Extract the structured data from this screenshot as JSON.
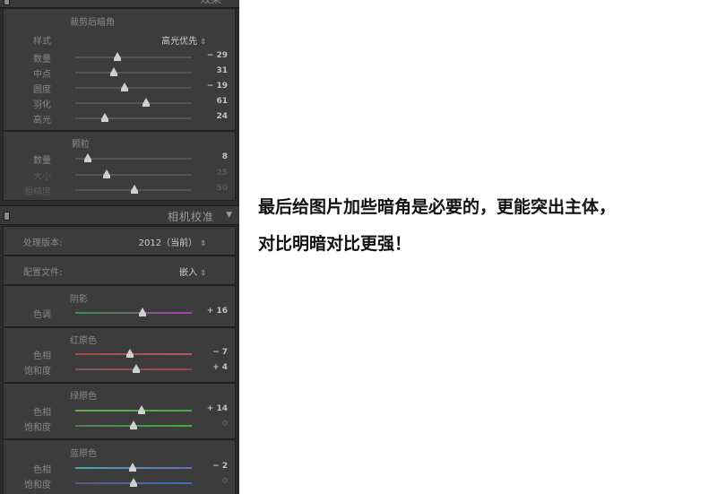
{
  "panel": {
    "top_header": {
      "title": "效果"
    },
    "vignette": {
      "title": "裁剪后暗角",
      "style_label": "样式",
      "style_value": "高光优先",
      "sliders": [
        {
          "label": "数量",
          "value": "− 29",
          "pos": 0.36
        },
        {
          "label": "中点",
          "value": "31",
          "pos": 0.33
        },
        {
          "label": "圆度",
          "value": "− 19",
          "pos": 0.42
        },
        {
          "label": "羽化",
          "value": "61",
          "pos": 0.61
        },
        {
          "label": "高光",
          "value": "24",
          "pos": 0.25
        }
      ]
    },
    "grain": {
      "title": "颗粒",
      "sliders": [
        {
          "label": "数量",
          "value": "8",
          "pos": 0.11
        },
        {
          "label": "大小",
          "value": "25",
          "pos": 0.27
        },
        {
          "label": "粗糙度",
          "value": "50",
          "pos": 0.51
        }
      ]
    },
    "camera_calibration": {
      "title": "相机校准",
      "process_label": "处理版本:",
      "process_value": "2012（当前）",
      "profile_label": "配置文件:",
      "profile_value": "嵌入",
      "shadows": {
        "title": "阴影",
        "sliders": [
          {
            "label": "色调",
            "value": "+ 16",
            "pos": 0.58
          }
        ]
      },
      "red": {
        "title": "红原色",
        "sliders": [
          {
            "label": "色相",
            "value": "− 7",
            "pos": 0.47
          },
          {
            "label": "饱和度",
            "value": "+ 4",
            "pos": 0.52
          }
        ]
      },
      "green": {
        "title": "绿原色",
        "sliders": [
          {
            "label": "色相",
            "value": "+ 14",
            "pos": 0.57
          },
          {
            "label": "饱和度",
            "value": "0",
            "pos": 0.5
          }
        ]
      },
      "blue": {
        "title": "蓝原色",
        "sliders": [
          {
            "label": "色相",
            "value": "− 2",
            "pos": 0.49
          },
          {
            "label": "饱和度",
            "value": "0",
            "pos": 0.5
          }
        ]
      }
    }
  },
  "caption": {
    "line1": "最后给图片加些暗角是必要的，更能突出主体，",
    "line2": "对比明暗对比更强！"
  },
  "colors": {
    "panel_bg": "#2b2b2b",
    "section_bg": "#3c3c3c",
    "thumb": "#cfcfcf",
    "shadow_tint_track": [
      "#2e9a3c",
      "#b03ab8"
    ],
    "red_hue_track": [
      "#a84a4a",
      "#b05a5a"
    ],
    "red_sat_track": [
      "#7a5a5a",
      "#b04040"
    ],
    "green_hue_track": [
      "#6aa85a",
      "#4aa84a"
    ],
    "green_sat_track": [
      "#5a7a5a",
      "#40b040"
    ],
    "blue_hue_track": [
      "#4aa8a0",
      "#6a6ac0"
    ],
    "blue_sat_track": [
      "#5a5a7a",
      "#4070c0"
    ]
  }
}
